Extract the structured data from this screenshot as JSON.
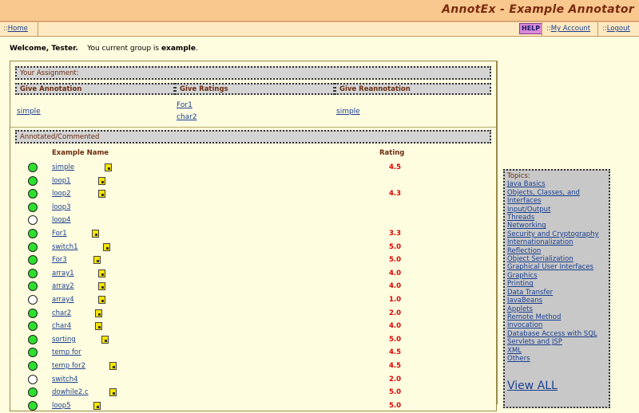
{
  "header": {
    "title": "AnnotEx - Example Annotator"
  },
  "nav": {
    "home": "Home",
    "help": "HELP",
    "my_account": "My Account",
    "logout": "Logout",
    "sep": "::"
  },
  "welcome": {
    "greeting": "Welcome, Tester.",
    "group_prefix": "You current group is",
    "group_name": "example",
    "group_suffix": "."
  },
  "assignment": {
    "title": "Your Assignment:",
    "col_annotation": "Give Annotation",
    "col_ratings": "Give Ratings",
    "col_reannotation": "Give Reannotation",
    "annotation_links": [
      "simple"
    ],
    "rating_links": [
      "For1",
      "char2"
    ],
    "reannotation_links": [
      "simple"
    ]
  },
  "annotated": {
    "title": "Annotated/Commented",
    "col_name": "Example Name",
    "col_rating": "Rating",
    "rows": [
      {
        "name": "simple",
        "status": "green",
        "note": true,
        "rating": "4.5"
      },
      {
        "name": "loop1",
        "status": "green",
        "note": true,
        "rating": ""
      },
      {
        "name": "loop2",
        "status": "green",
        "note": true,
        "rating": "4.3"
      },
      {
        "name": "loop3",
        "status": "green",
        "note": false,
        "rating": ""
      },
      {
        "name": "loop4",
        "status": "white",
        "note": false,
        "rating": ""
      },
      {
        "name": "For1",
        "status": "green",
        "note": true,
        "rating": "3.3"
      },
      {
        "name": "switch1",
        "status": "green",
        "note": true,
        "rating": "5.0"
      },
      {
        "name": "For3",
        "status": "green",
        "note": true,
        "rating": "5.0"
      },
      {
        "name": "array1",
        "status": "green",
        "note": true,
        "rating": "4.0"
      },
      {
        "name": "array2",
        "status": "green",
        "note": true,
        "rating": "4.0"
      },
      {
        "name": "array4",
        "status": "white",
        "note": true,
        "rating": "1.0"
      },
      {
        "name": "char2",
        "status": "green",
        "note": true,
        "rating": "2.0"
      },
      {
        "name": "char4",
        "status": "green",
        "note": true,
        "rating": "4.0"
      },
      {
        "name": "sorting",
        "status": "green",
        "note": true,
        "rating": "5.0"
      },
      {
        "name": "temp for",
        "status": "green",
        "note": false,
        "rating": "4.5"
      },
      {
        "name": "temp for2",
        "status": "green",
        "note": true,
        "rating": "4.5"
      },
      {
        "name": "switch4",
        "status": "white",
        "note": false,
        "rating": "2.0"
      },
      {
        "name": "dowhile2.c",
        "status": "green",
        "note": true,
        "rating": "5.0"
      },
      {
        "name": "loop5",
        "status": "green",
        "note": true,
        "rating": "5.0"
      }
    ]
  },
  "topics": {
    "title": "Topics:",
    "items": [
      "Java Basics",
      "Objects, Classes, and",
      "Interfaces",
      "Input/Output",
      "Threads",
      "Networking",
      "Security and Cryptography",
      "Internationalization",
      "Reflection",
      "Object Serialization",
      "Graphical User Interfaces",
      "Graphics",
      "Printing",
      "Data Transfer",
      "JavaBeans",
      "Applets",
      "Remote Method",
      "Invocation",
      "Database Access with SQL",
      "Servlets and JSP",
      "XML",
      "Others"
    ],
    "view_all": "View ALL"
  },
  "colors": {
    "header_bg": "#f8c88e",
    "nav_bg": "#fde9c2",
    "page_bg": "#fffde0",
    "title": "#7a2b0e",
    "rating": "#e00000",
    "status_green": "#2ee02e",
    "help_bg": "#d88ad8"
  }
}
